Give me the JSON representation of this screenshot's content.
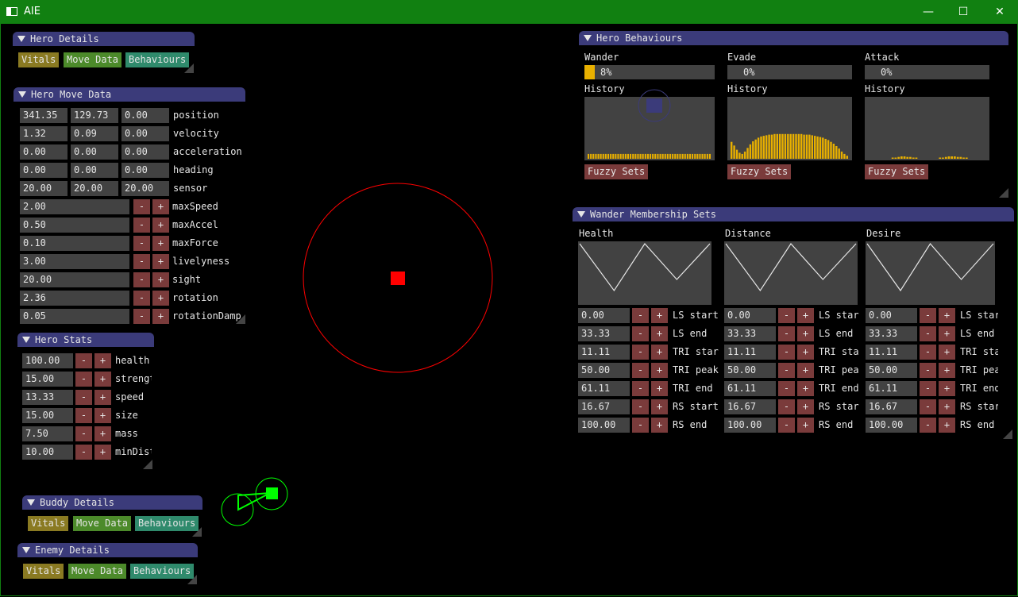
{
  "window": {
    "title": "AIE"
  },
  "hero_details": {
    "title": "Hero Details",
    "vitals": "Vitals",
    "move_data": "Move Data",
    "behaviours": "Behaviours"
  },
  "hero_move_data": {
    "title": "Hero Move Data",
    "vectors": [
      {
        "label": "position",
        "values": [
          "341.35",
          "129.73",
          "0.00"
        ]
      },
      {
        "label": "velocity",
        "values": [
          "1.32",
          "0.09",
          "0.00"
        ]
      },
      {
        "label": "acceleration",
        "values": [
          "0.00",
          "0.00",
          "0.00"
        ]
      },
      {
        "label": "heading",
        "values": [
          "0.00",
          "0.00",
          "0.00"
        ]
      },
      {
        "label": "sensor",
        "values": [
          "20.00",
          "20.00",
          "20.00"
        ]
      }
    ],
    "scalars": [
      {
        "label": "maxSpeed",
        "value": "2.00"
      },
      {
        "label": "maxAccel",
        "value": "0.50"
      },
      {
        "label": "maxForce",
        "value": "0.10"
      },
      {
        "label": "livelyness",
        "value": "3.00"
      },
      {
        "label": "sight",
        "value": "20.00"
      },
      {
        "label": "rotation",
        "value": "2.36"
      },
      {
        "label": "rotationDamp",
        "value": "0.05"
      }
    ],
    "minus": "-",
    "plus": "+"
  },
  "hero_stats": {
    "title": "Hero Stats",
    "rows": [
      {
        "label": "health",
        "value": "100.00"
      },
      {
        "label": "strengt",
        "value": "15.00"
      },
      {
        "label": "speed",
        "value": "13.33"
      },
      {
        "label": "size",
        "value": "15.00"
      },
      {
        "label": "mass",
        "value": "7.50"
      },
      {
        "label": "minDist",
        "value": "10.00"
      }
    ]
  },
  "buddy_details": {
    "title": "Buddy Details",
    "vitals": "Vitals",
    "move_data": "Move Data",
    "behaviours": "Behaviours"
  },
  "enemy_details": {
    "title": "Enemy Details",
    "vitals": "Vitals",
    "move_data": "Move Data",
    "behaviours": "Behaviours"
  },
  "hero_behaviours": {
    "title": "Hero Behaviours",
    "history_label": "History",
    "fuzzy_label": "Fuzzy Sets",
    "columns": [
      {
        "name": "Wander",
        "percent": "8%",
        "level": 0.08,
        "history": [
          0.08,
          0.08,
          0.08,
          0.08,
          0.08,
          0.08,
          0.08,
          0.08,
          0.08,
          0.08,
          0.08,
          0.08,
          0.08,
          0.08,
          0.08,
          0.08,
          0.08,
          0.08,
          0.08,
          0.08,
          0.08,
          0.08,
          0.08,
          0.08,
          0.08,
          0.08,
          0.08,
          0.08,
          0.08,
          0.08,
          0.08,
          0.08,
          0.08,
          0.08,
          0.08,
          0.08,
          0.08,
          0.08,
          0.08,
          0.08,
          0.08,
          0.08,
          0.08,
          0.08,
          0.08,
          0.08,
          0.08,
          0.08,
          0.08,
          0.08
        ]
      },
      {
        "name": "Evade",
        "percent": "0%",
        "level": 0.0,
        "history": [
          0.28,
          0.22,
          0.15,
          0.1,
          0.08,
          0.12,
          0.18,
          0.24,
          0.29,
          0.32,
          0.35,
          0.37,
          0.38,
          0.39,
          0.4,
          0.4,
          0.41,
          0.41,
          0.41,
          0.41,
          0.41,
          0.41,
          0.41,
          0.41,
          0.41,
          0.41,
          0.41,
          0.4,
          0.4,
          0.4,
          0.39,
          0.38,
          0.37,
          0.36,
          0.35,
          0.33,
          0.31,
          0.28,
          0.25,
          0.21,
          0.17,
          0.12,
          0.08,
          0.05
        ]
      },
      {
        "name": "Attack",
        "percent": "0%",
        "level": 0.0,
        "history": [
          0,
          0,
          0,
          0,
          0,
          0,
          0,
          0,
          0.02,
          0.02,
          0.03,
          0.04,
          0.04,
          0.03,
          0.03,
          0.02,
          0.02,
          0,
          0,
          0,
          0,
          0,
          0,
          0,
          0.02,
          0.02,
          0.03,
          0.04,
          0.04,
          0.04,
          0.03,
          0.03,
          0.02,
          0.02,
          0,
          0,
          0,
          0,
          0,
          0
        ]
      }
    ]
  },
  "wander_membership": {
    "title": "Wander Membership Sets",
    "columns": [
      {
        "name": "Health",
        "labels": [
          "LS start",
          "LS end",
          "TRI star",
          "TRI peak",
          "TRI end",
          "RS start",
          "RS end"
        ]
      },
      {
        "name": "Distance",
        "labels": [
          "LS star",
          "LS end",
          "TRI sta",
          "TRI pea",
          "TRI end",
          "RS star",
          "RS end"
        ]
      },
      {
        "name": "Desire",
        "labels": [
          "LS star",
          "LS end",
          "TRI sta",
          "TRI pea",
          "TRI end",
          "RS star",
          "RS end"
        ]
      }
    ],
    "values": [
      "0.00",
      "33.33",
      "11.11",
      "50.00",
      "61.11",
      "16.67",
      "100.00"
    ]
  },
  "colors": {
    "title_bar": "#118011",
    "panel_header": "#3b3b7a",
    "histogram": "#e8b000",
    "hero": "#ff0000",
    "buddy": "#00ff00"
  }
}
